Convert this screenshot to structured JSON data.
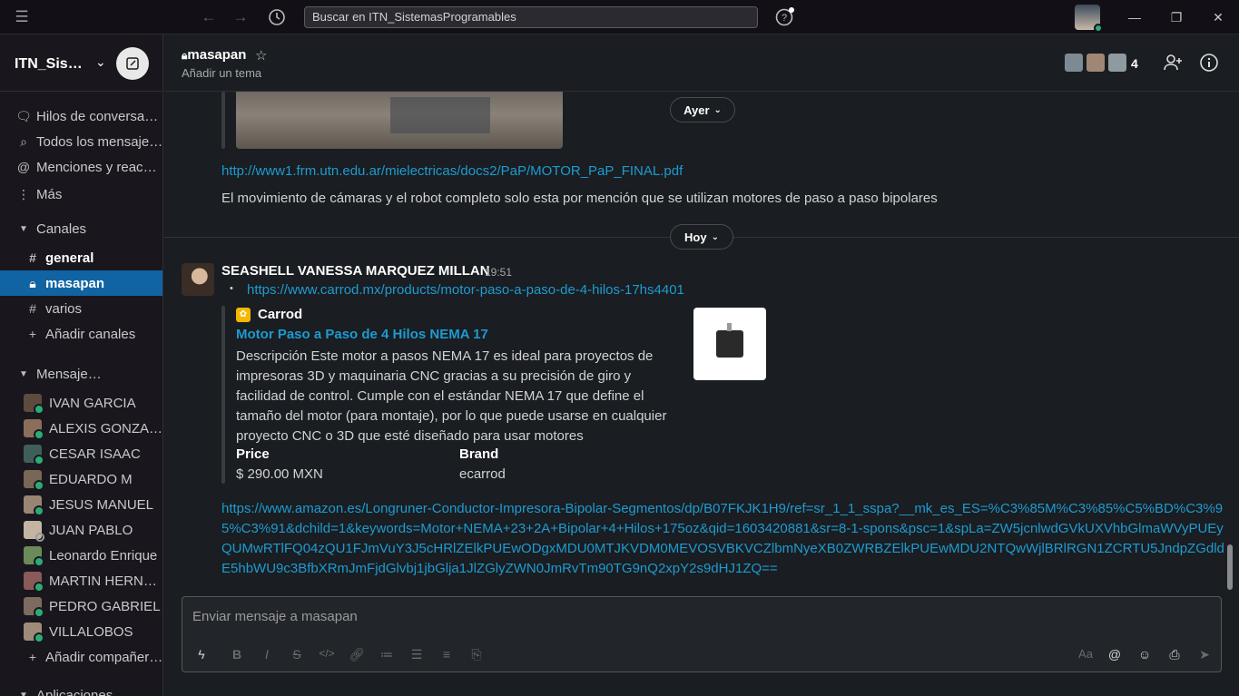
{
  "search": {
    "placeholder": "Buscar en ITN_SistemasProgramables"
  },
  "workspace": {
    "name": "ITN_SistemasProgramables"
  },
  "sidebar": {
    "nav": [
      {
        "label": "Hilos de conversación",
        "icon": "threads-icon"
      },
      {
        "label": "Todos los mensajes directos",
        "icon": "dm-icon"
      },
      {
        "label": "Menciones y reacciones",
        "icon": "at-icon"
      },
      {
        "label": "Más",
        "icon": "more-icon"
      }
    ],
    "channels_header": "Canales",
    "channels": [
      {
        "label": "general",
        "icon": "#"
      },
      {
        "label": "masapan",
        "icon": "lock"
      },
      {
        "label": "varios",
        "icon": "#"
      }
    ],
    "add_channels": "Añadir canales",
    "dm_header": "Mensajes directos",
    "dms": [
      "IVAN GARCIA",
      "ALEXIS GONZALEZ",
      "CESAR ISAAC",
      "EDUARDO M",
      "JESUS MANUEL",
      "JUAN PABLO",
      "Leonardo Enrique",
      "MARTIN HERNANDEZ",
      "PEDRO GABRIEL",
      "VILLALOBOS"
    ],
    "add_teammates": "Añadir compañeros",
    "bottom_label": "Aplicaciones"
  },
  "channel": {
    "name": "masapan",
    "topic": "Añadir un tema",
    "member_count": "4"
  },
  "messages": {
    "prev_link": "http://www1.frm.utn.edu.ar/mielectricas/docs2/PaP/MOTOR_PaP_FINAL.pdf",
    "prev_text": "El movimiento de cámaras y el robot completo solo esta por mención que se utilizan motores de paso a paso bipolares",
    "day_yesterday": "Ayer",
    "day_today": "Hoy",
    "author": "SEASHELL VANESSA MARQUEZ MILLAN",
    "time": "19:51",
    "bullet": "•",
    "link1": "https://www.carrod.mx/products/motor-paso-a-paso-de-4-hilos-17hs4401",
    "unfurl": {
      "brand": "Carrod",
      "title": "Motor Paso a Paso de 4 Hilos NEMA 17",
      "description": "Descripción Este motor a pasos NEMA 17 es ideal para proyectos de impresoras 3D y maquinaria CNC gracias a su precisión de giro y facilidad de control. Cumple con el estándar NEMA 17 que define el tamaño del motor (para montaje), por lo que puede usarse en cualquier proyecto CNC o 3D que esté diseñado para usar motores",
      "price_label": "Price",
      "price_value": "$ 290.00 MXN",
      "brand_label": "Brand",
      "brand_value": "ecarrod"
    },
    "link2": "https://www.amazon.es/Longruner-Conductor-Impresora-Bipolar-Segmentos/dp/B07FKJK1H9/ref=sr_1_1_sspa?__mk_es_ES=%C3%85M%C3%85%C5%BD%C3%95%C3%91&dchild=1&keywords=Motor+NEMA+23+2A+Bipolar+4+Hilos+175oz&qid=1603420881&sr=8-1-spons&psc=1&spLa=ZW5jcnlwdGVkUXVhbGlmaWVyPUEyQUMwRTlFQ04zQU1FJmVuY3J5cHRlZElkPUEwODgxMDU0MTJKVDM0MEVOSVBKVCZlbmNyeXB0ZWRBZElkPUEwMDU2NTQwWjlBRlRGN1ZCRTU5JndpZGdldE5hbWU9c3BfbXRmJmFjdGlvbj1jbGlja1JlZGlyZWN0JmRvTm90TG9nQ2xpY2s9dHJ1ZQ=="
  },
  "composer": {
    "placeholder": "Enviar mensaje a masapan"
  },
  "colors": {
    "accent": "#1164a3",
    "link": "#1d9bd1",
    "online": "#2bac76",
    "background": "#1a1d21"
  }
}
